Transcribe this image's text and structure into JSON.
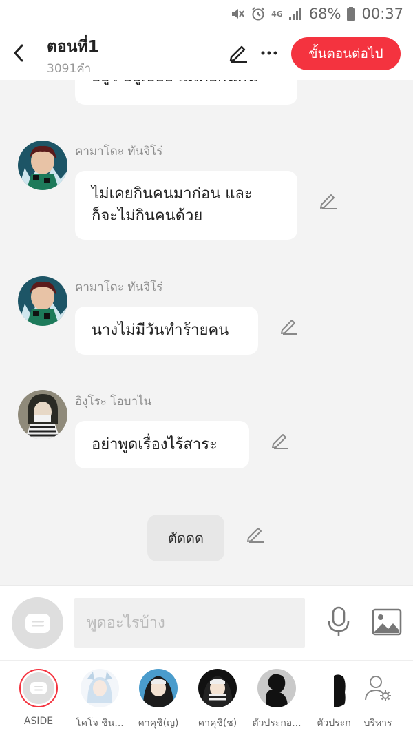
{
  "status_bar": {
    "battery_percent": "68%",
    "time": "00:37",
    "network": "4G",
    "icons": [
      "mute-icon",
      "alarm-icon",
      "4g-icon",
      "signal-icon",
      "battery-icon"
    ]
  },
  "header": {
    "title": "ตอนที่1",
    "word_count": "3091คำ",
    "next_button": "ขั้นตอนต่อไป",
    "colors": {
      "accent": "#f4333f"
    }
  },
  "messages": [
    {
      "type": "cut",
      "text": "อยู่ว ฮยูเธยอ เมเคยกนคน"
    },
    {
      "type": "character",
      "name": "คามาโดะ ทันจิโร่",
      "text_lines": [
        "ไม่เคยกินคนมาก่อน และ",
        "ก็จะไม่กินคนด้วย"
      ]
    },
    {
      "type": "character",
      "name": "คามาโดะ ทันจิโร่",
      "text": "นางไม่มีวันทำร้ายคน"
    },
    {
      "type": "character",
      "name": "อิงุโระ โอบาไน",
      "text": "อย่าพูดเรื่องไร้สาระ"
    },
    {
      "type": "aside",
      "text": "ตัดดด"
    }
  ],
  "composer": {
    "placeholder": "พูดอะไรบ้าง"
  },
  "character_bar": [
    {
      "label": "ASIDE",
      "icon": "aside-icon",
      "selected": true
    },
    {
      "label": "โคโจ ชิน..."
    },
    {
      "label": "คาคุชิ(ญ)"
    },
    {
      "label": "คาคุชิ(ช)"
    },
    {
      "label": "ตัวประกอ..."
    },
    {
      "label": "ตัวประก"
    },
    {
      "label": "บริหาร",
      "icon": "manage-icon"
    }
  ]
}
